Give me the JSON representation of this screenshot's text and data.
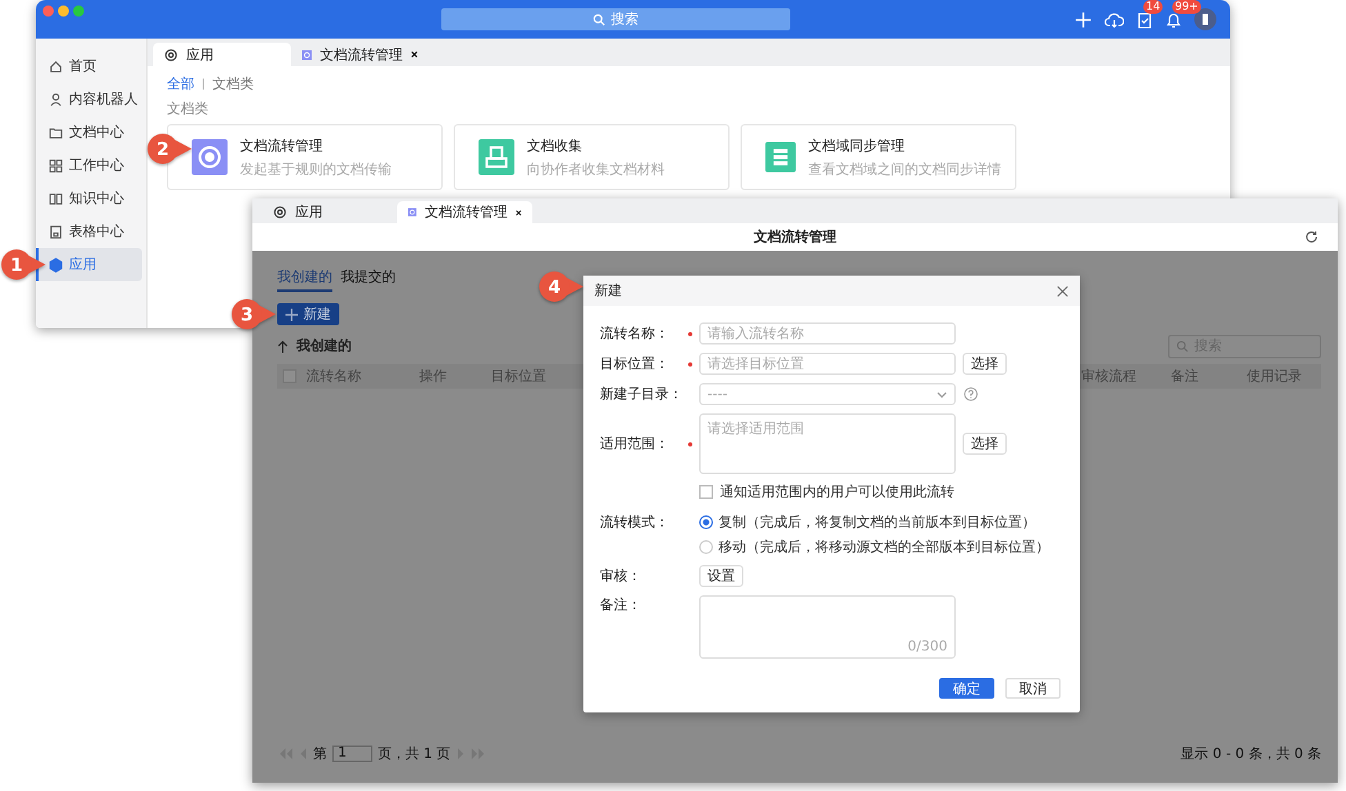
{
  "main_window": {
    "search": {
      "placeholder": "搜索"
    },
    "task_badge": "14",
    "notification_badge": "99+",
    "sidebar": {
      "items": [
        {
          "label": "首页",
          "selected": false
        },
        {
          "label": "内容机器人",
          "selected": false
        },
        {
          "label": "文档中心",
          "selected": false
        },
        {
          "label": "工作中心",
          "selected": false
        },
        {
          "label": "知识中心",
          "selected": false
        },
        {
          "label": "表格中心",
          "selected": false
        },
        {
          "label": "应用",
          "selected": true
        }
      ]
    },
    "tabs": [
      {
        "label": "应用",
        "selected": true,
        "closable": false
      },
      {
        "label": "文档流转管理",
        "selected": false,
        "closable": true
      }
    ],
    "breadcrumb": [
      {
        "label": "全部",
        "selected": true
      },
      {
        "label": "文档类",
        "selected": false
      }
    ],
    "section_label": "文档类",
    "cards": [
      {
        "title": "文档流转管理",
        "description": "发起基于规则的文档传输",
        "color": "#8a8ff5"
      },
      {
        "title": "文档收集",
        "description": "向协作者收集文档材料",
        "color": "#3ec9a0"
      },
      {
        "title": "文档域同步管理",
        "description": "查看文档域之间的文档同步详情",
        "color": "#3ec9a0"
      }
    ]
  },
  "module_window": {
    "tabs": [
      {
        "label": "应用",
        "selected": false,
        "closable": false
      },
      {
        "label": "文档流转管理",
        "selected": true,
        "closable": true
      }
    ],
    "title": "文档流转管理",
    "subtabs": [
      {
        "label": "我创建的",
        "selected": true
      },
      {
        "label": "我提交的",
        "selected": false
      }
    ],
    "new_button": "新建",
    "list_title": "我创建的",
    "search": {
      "placeholder": "搜索"
    },
    "table": {
      "select_all_checked": false,
      "columns": [
        "流转名称",
        "操作",
        "目标位置",
        "审核流程",
        "备注",
        "使用记录"
      ]
    },
    "pagination": {
      "prefix": "第",
      "page": "1",
      "suffix": "页，共 1 页",
      "summary": "显示 0 - 0 条，共 0 条"
    }
  },
  "dialog": {
    "title": "新建",
    "fields": [
      {
        "kind": "input",
        "label": "流转名称：",
        "required": true,
        "placeholder": "请输入流转名称"
      },
      {
        "kind": "input",
        "label": "目标位置：",
        "required": true,
        "placeholder": "请选择目标位置",
        "button": "选择"
      },
      {
        "kind": "select",
        "label": "新建子目录：",
        "required": false,
        "placeholder": "----"
      },
      {
        "kind": "textarea",
        "label": "适用范围：",
        "required": true,
        "placeholder": "请选择适用范围",
        "button": "选择"
      }
    ],
    "notify": {
      "label": "通知适用范围内的用户可以使用此流转",
      "checked": false
    },
    "mode": {
      "label": "流转模式：",
      "options": [
        {
          "label": "复制（完成后，将复制文档的当前版本到目标位置）",
          "selected": true
        },
        {
          "label": "移动（完成后，将移动源文档的全部版本到目标位置）",
          "selected": false
        }
      ]
    },
    "review": {
      "label": "审核：",
      "button": "设置"
    },
    "notes": {
      "label": "备注：",
      "counter": "0/300"
    },
    "buttons": [
      {
        "label": "确定",
        "kind": "primary"
      },
      {
        "label": "取消",
        "kind": "default"
      }
    ]
  },
  "callouts": [
    "1",
    "2",
    "3",
    "4"
  ]
}
